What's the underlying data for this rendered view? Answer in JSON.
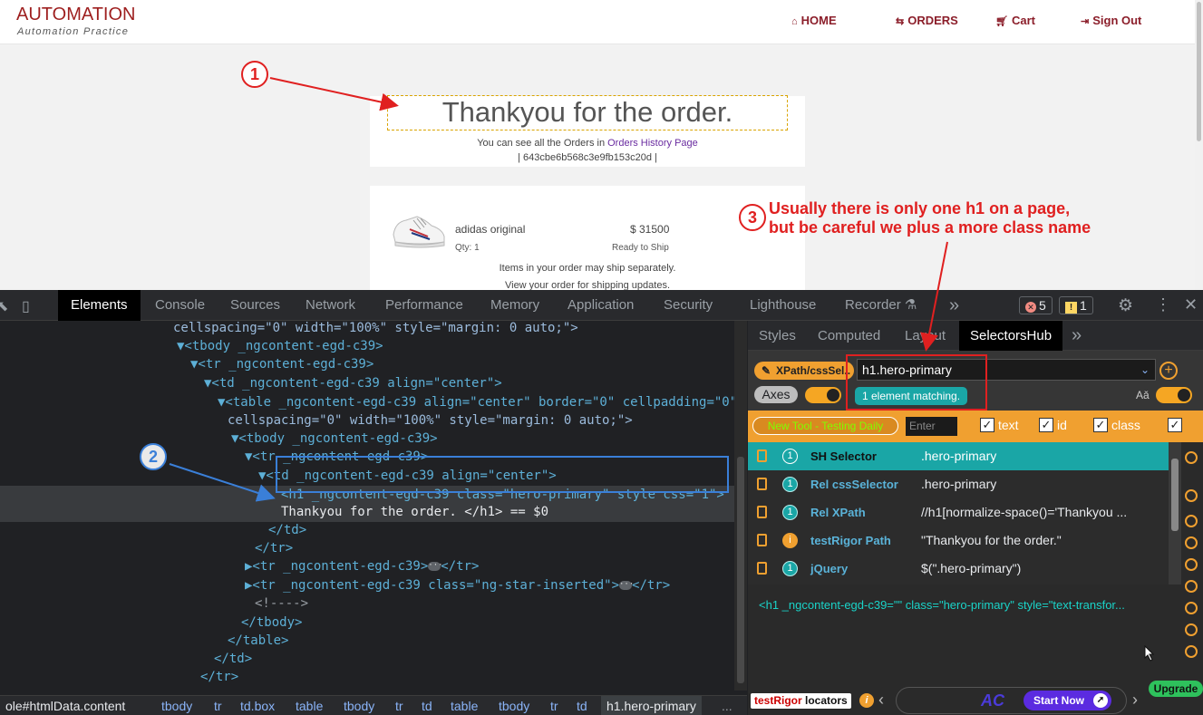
{
  "site": {
    "brand": "AUTOMATION",
    "brand_sub": "Automation Practice",
    "nav": [
      {
        "icon": "home-icon",
        "label": "HOME"
      },
      {
        "icon": "orders-icon",
        "label": "ORDERS"
      },
      {
        "icon": "cart-icon",
        "label": "Cart"
      },
      {
        "icon": "sign-out-icon",
        "label": "Sign Out"
      }
    ],
    "hero_title": "Thankyou for the order.",
    "orders_prefix": "You can see all the Orders in ",
    "orders_link": "Orders History Page",
    "order_id": "| 643cbe6b568c3e9fb153c20d |",
    "product_name": "adidas original",
    "product_qty": "Qty: 1",
    "product_price": "$ 31500",
    "product_status": "Ready to Ship",
    "note_ship": "Items in your order may ship separately.",
    "note_view": "View your order for shipping updates."
  },
  "annotations": {
    "one": "1",
    "two": "2",
    "three": "3",
    "note_line1": "Usually there is only one h1 on a page,",
    "note_line2": "but be careful we plus a more class name",
    "color": "#e02020"
  },
  "devtools": {
    "tabs": [
      "Elements",
      "Console",
      "Sources",
      "Network",
      "Performance",
      "Memory",
      "Application",
      "Security",
      "Lighthouse",
      "Recorder"
    ],
    "more": "»",
    "errors": "5",
    "warnings": "1",
    "dom_lines": [
      "cellspacing=\"0\" width=\"100%\" style=\"margin: 0 auto;\">",
      "▼<tbody _ngcontent-egd-c39>",
      "▼<tr _ngcontent-egd-c39>",
      "▼<td _ngcontent-egd-c39 align=\"center\">",
      "▼<table _ngcontent-egd-c39 align=\"center\" border=\"0\" cellpadding=\"0\"",
      "cellspacing=\"0\" width=\"100%\" style=\"margin: 0 auto;\">",
      "▼<tbody _ngcontent-egd-c39>",
      "▼<tr _ngcontent-egd-c39>",
      "▼<td _ngcontent-egd-c39 align=\"center\">",
      "<h1 _ngcontent-egd-c39 class=\"hero-primary\" style css=\"1\">",
      "Thankyou for the order. </h1> == $0",
      "</td>",
      "</tr>",
      "▶<tr _ngcontent-egd-c39>",
      "</tr>",
      "▶<tr _ngcontent-egd-c39 class=\"ng-star-inserted\">",
      "</tr>",
      "<!---->",
      "</tbody>",
      "</table>",
      "</td>",
      "</tr>"
    ],
    "breadcrumbs": [
      "ole#htmlData.content",
      "tbody",
      "tr",
      "td.box",
      "table",
      "tbody",
      "tr",
      "td",
      "table",
      "tbody",
      "tr",
      "td",
      "h1.hero-primary"
    ],
    "breadcrumb_more": "...",
    "side_tabs": [
      "Styles",
      "Computed",
      "Layout",
      "SelectorsHub"
    ],
    "side_more": "»"
  },
  "selectorshub": {
    "mode_button": "XPath/cssSel..",
    "query": "h1.hero-primary",
    "match": "1 element matching.",
    "axes": "Axes",
    "new_tool": "New Tool - Testing Daily",
    "enter_placeholder": "Enter",
    "checks": [
      "text",
      "id",
      "class"
    ],
    "rows": [
      {
        "count": "1",
        "label": "SH Selector",
        "value": ".hero-primary"
      },
      {
        "count": "1",
        "label": "Rel cssSelector",
        "value": ".hero-primary"
      },
      {
        "count": "1",
        "label": "Rel XPath",
        "value": "//h1[normalize-space()='Thankyou ..."
      },
      {
        "count": "i",
        "label": "testRigor Path",
        "value": "\"Thankyou for the order.\""
      },
      {
        "count": "1",
        "label": "jQuery",
        "value": "$(\".hero-primary\")"
      }
    ],
    "outer_html": "<h1 _ngcontent-egd-c39=\"\" class=\"hero-primary\" style=\"text-transfor...",
    "testrigor": "testRigor",
    "locators": "locators",
    "start_now": "Start Now",
    "upgrade": "Upgrade",
    "ad_logo": "AC"
  }
}
